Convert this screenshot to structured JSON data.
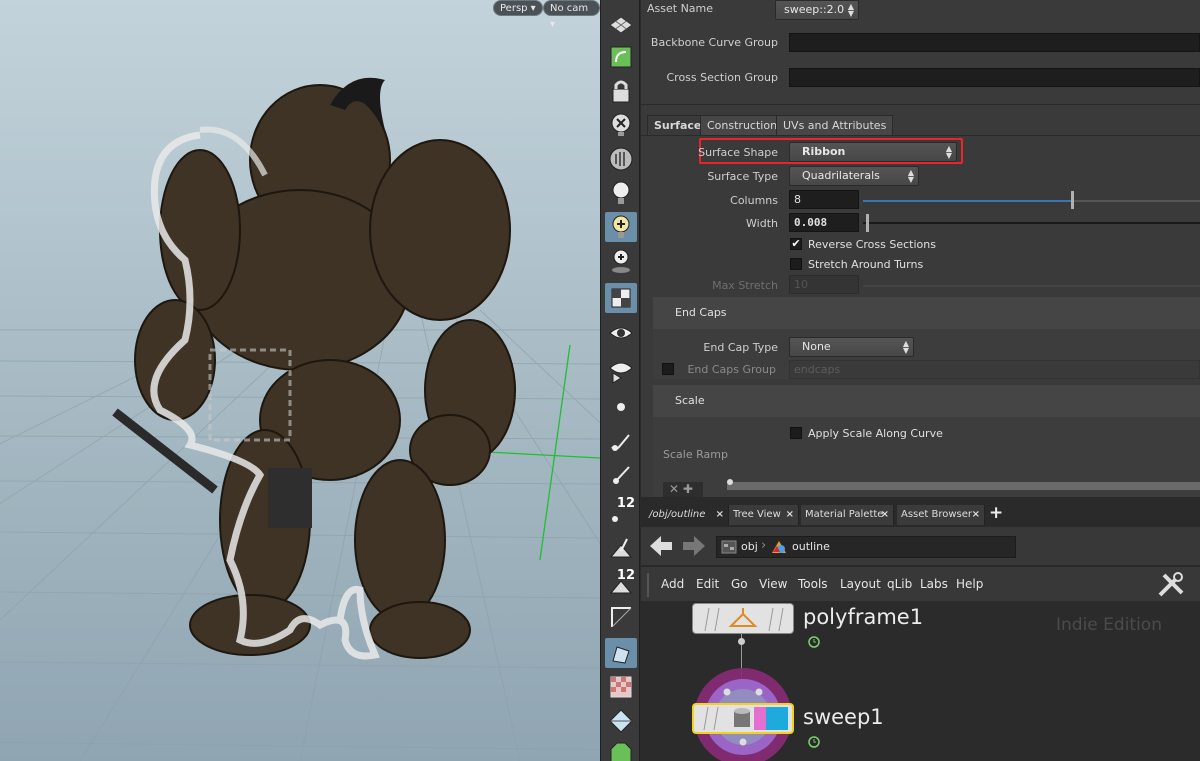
{
  "viewport": {
    "persp_label": "Persp",
    "cam_label": "No cam"
  },
  "params": {
    "asset_name_label": "Asset Name",
    "asset_name_value": "sweep::2.0",
    "backbone_label": "Backbone Curve Group",
    "cross_section_label": "Cross Section Group",
    "tabs": [
      {
        "label": "Surface"
      },
      {
        "label": "Construction"
      },
      {
        "label": "UVs and Attributes"
      }
    ],
    "surface_shape_label": "Surface Shape",
    "surface_shape_value": "Ribbon",
    "surface_type_label": "Surface Type",
    "surface_type_value": "Quadrilaterals",
    "columns_label": "Columns",
    "columns_value": "8",
    "columns_fraction": 0.62,
    "width_label": "Width",
    "width_value": "0.008",
    "reverse_label": "Reverse Cross Sections",
    "reverse_checked": true,
    "stretch_label": "Stretch Around Turns",
    "stretch_checked": false,
    "max_stretch_label": "Max Stretch",
    "max_stretch_value": "10",
    "end_caps_folder": "End Caps",
    "end_cap_type_label": "End Cap Type",
    "end_cap_type_value": "None",
    "end_caps_group_label": "End Caps Group",
    "end_caps_group_value": "endcaps",
    "scale_folder": "Scale",
    "apply_scale_label": "Apply Scale Along Curve",
    "scale_ramp_label": "Scale Ramp"
  },
  "network": {
    "tabs": [
      {
        "label": "/obj/outline"
      },
      {
        "label": "Tree View"
      },
      {
        "label": "Material Palette"
      },
      {
        "label": "Asset Browser"
      }
    ],
    "add_tab": "+",
    "path": [
      {
        "label": "obj"
      },
      {
        "label": "outline"
      }
    ],
    "menu": [
      "Add",
      "Edit",
      "Go",
      "View",
      "Tools",
      "Layout",
      "qLib",
      "Labs",
      "Help"
    ],
    "nodes": [
      {
        "name": "polyframe1"
      },
      {
        "name": "sweep1"
      }
    ],
    "watermark": "Indie Edition"
  },
  "shelf": {
    "badge_1": "12",
    "badge_2": "12"
  },
  "colors": {
    "highlight": "#e8262a",
    "accent": "#3a73b8",
    "node_selected": "#f2d21b"
  }
}
